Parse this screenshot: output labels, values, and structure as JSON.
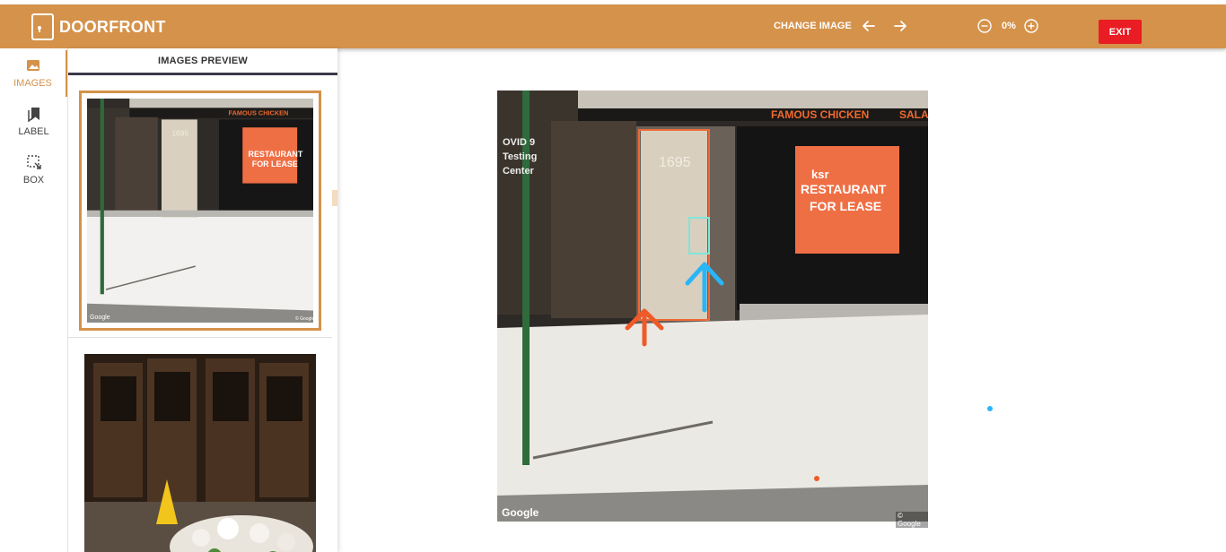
{
  "app": {
    "name": "DOORFRONT"
  },
  "toolbar": {
    "change_image_label": "CHANGE IMAGE",
    "prev_icon": "arrow-left-icon",
    "next_icon": "arrow-right-icon",
    "zoom_out_icon": "zoom-out-icon",
    "zoom_value": "0%",
    "zoom_in_icon": "zoom-in-icon",
    "exit_label": "EXIT"
  },
  "sidenav": {
    "items": [
      {
        "label": "IMAGES",
        "icon": "image-icon",
        "active": true
      },
      {
        "label": "LABEL",
        "icon": "bookmark-icon",
        "active": false
      },
      {
        "label": "BOX",
        "icon": "bounding-box-icon",
        "active": false
      }
    ]
  },
  "preview": {
    "title": "IMAGES PREVIEW",
    "thumbnails": [
      {
        "selected": true,
        "watermark_left": "Google",
        "watermark_right": "© Google"
      },
      {
        "selected": false
      }
    ]
  },
  "main_image": {
    "store_sign": "FAMOUS CHICKEN",
    "store_sign_partial": "SALA",
    "door_number": "1695",
    "poster_brand": "ksr",
    "poster_line1": "RESTAURANT",
    "poster_line2": "FOR LEASE",
    "left_sign_lines": [
      "OVID 9",
      "Testing",
      "Center"
    ],
    "watermark_left": "Google",
    "watermark_right": "© Google"
  },
  "colors": {
    "topbar": "#d5924a",
    "accent": "#d5924a",
    "exit": "#ea1c24",
    "door_box": "#f06a35",
    "handle_box": "#7fe6d8",
    "arrow_orange": "#f05a28",
    "arrow_blue": "#29b6f6"
  }
}
